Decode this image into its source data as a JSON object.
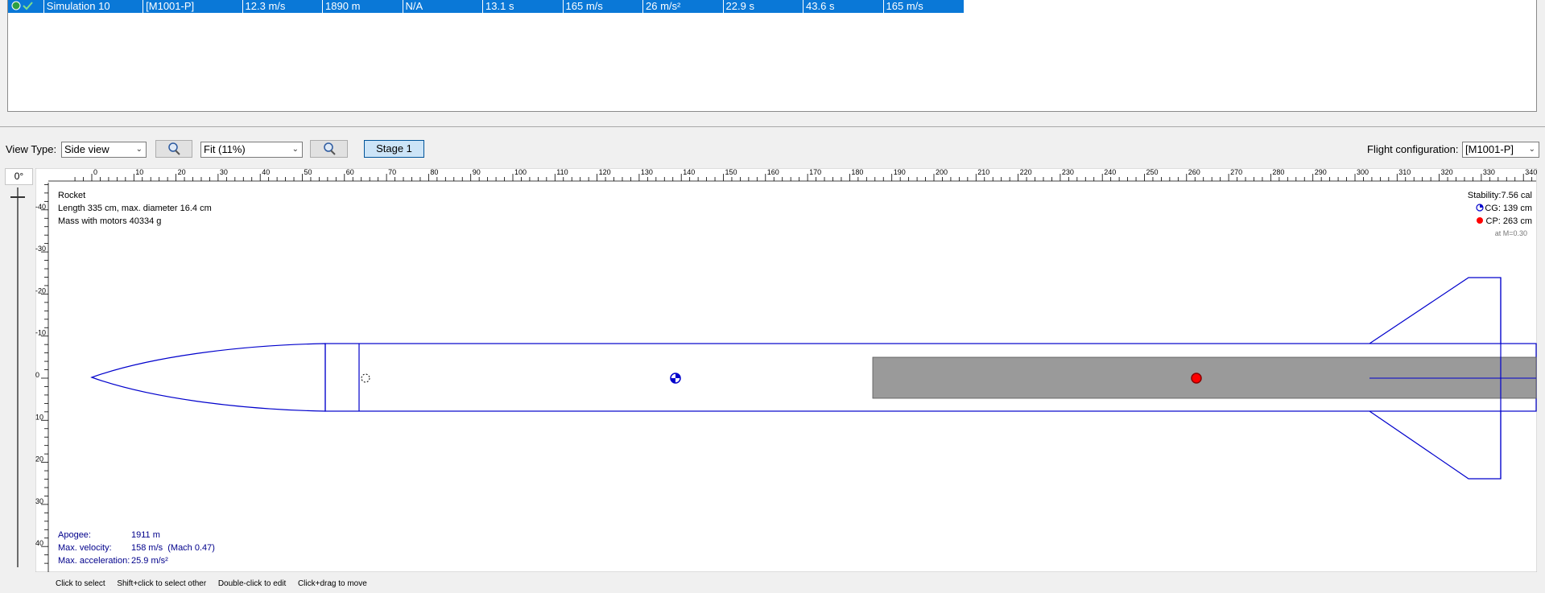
{
  "simulation_row": {
    "name": "Simulation 10",
    "config": "[M1001-P]",
    "velocity_off_rod": "12.3 m/s",
    "apogee": "1890 m",
    "optimum_delay": "N/A",
    "time_to_apogee": "13.1 s",
    "max_velocity": "165 m/s",
    "max_acceleration": "26 m/s²",
    "velocity_at_deploy": "22.9 s",
    "flight_time": "43.6 s",
    "ground_hit_velocity": "165 m/s",
    "status_colors": {
      "ok": "#2ea043",
      "row_bg": "#0a78d7"
    }
  },
  "toolbar": {
    "view_type_label": "View Type:",
    "view_type_value": "Side view",
    "zoom_in_icon": "zoom-in-icon",
    "zoom_value": "Fit (11%)",
    "zoom_out_icon": "zoom-out-icon",
    "stage_button": "Stage 1",
    "flight_config_label": "Flight configuration:",
    "flight_config_value": "[M1001-P]"
  },
  "rotation": {
    "value": "0°"
  },
  "ruler": {
    "unit": "cm",
    "horizontal_ticks": [
      "0",
      "10",
      "20",
      "30",
      "40",
      "50",
      "60",
      "70",
      "80",
      "90",
      "100",
      "110",
      "120",
      "130",
      "140",
      "150",
      "160",
      "170",
      "180",
      "190",
      "200",
      "210",
      "220",
      "230",
      "240",
      "250",
      "260",
      "270",
      "280",
      "290",
      "300",
      "310",
      "320",
      "330",
      "340"
    ],
    "vertical_ticks": [
      "-40",
      "-30",
      "-20",
      "-10",
      "0",
      "10",
      "20",
      "30",
      "40"
    ]
  },
  "rocket_info": {
    "name": "Rocket",
    "dimensions": "Length 335 cm, max. diameter 16.4 cm",
    "mass": "Mass with motors 40334 g"
  },
  "stability": {
    "stability": "Stability:7.56 cal",
    "cg": "CG: 139 cm",
    "cp": "CP: 263 cm",
    "mach": "at M=0.30"
  },
  "flight_data": {
    "apogee_label": "Apogee:",
    "apogee_value": "1911 m",
    "velocity_label": "Max. velocity:",
    "velocity_value": "158 m/s  (Mach 0.47)",
    "accel_label": "Max. acceleration:",
    "accel_value": "25.9 m/s²"
  },
  "status_bar": {
    "hint1": "Click to select",
    "hint2": "Shift+click to select other",
    "hint3": "Double-click to edit",
    "hint4": "Click+drag to move"
  },
  "colors": {
    "outline": "#0000cc",
    "motor": "#9a9a9a",
    "cp_marker": "#ff0000",
    "cg_marker": "#0000cc"
  }
}
